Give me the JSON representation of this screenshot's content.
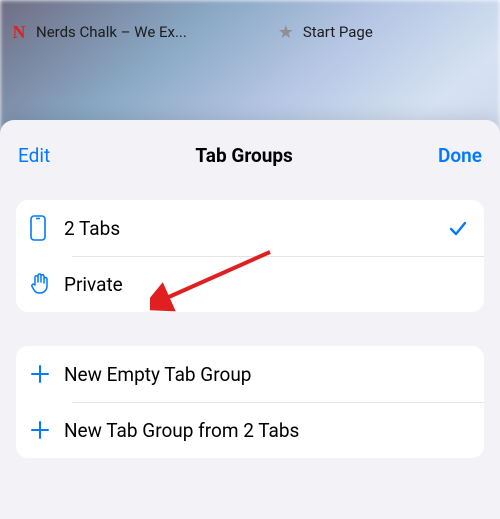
{
  "tabs": [
    {
      "title": "Nerds Chalk – We Ex...",
      "icon": "n"
    },
    {
      "title": "Start Page",
      "icon": "star"
    }
  ],
  "sheet": {
    "edit": "Edit",
    "title": "Tab Groups",
    "done": "Done"
  },
  "groups": [
    {
      "label": "2 Tabs",
      "icon": "device",
      "selected": true
    },
    {
      "label": "Private",
      "icon": "hand",
      "selected": false
    }
  ],
  "actions": [
    {
      "label": "New Empty Tab Group",
      "icon": "plus"
    },
    {
      "label": "New Tab Group from 2 Tabs",
      "icon": "plus"
    }
  ]
}
